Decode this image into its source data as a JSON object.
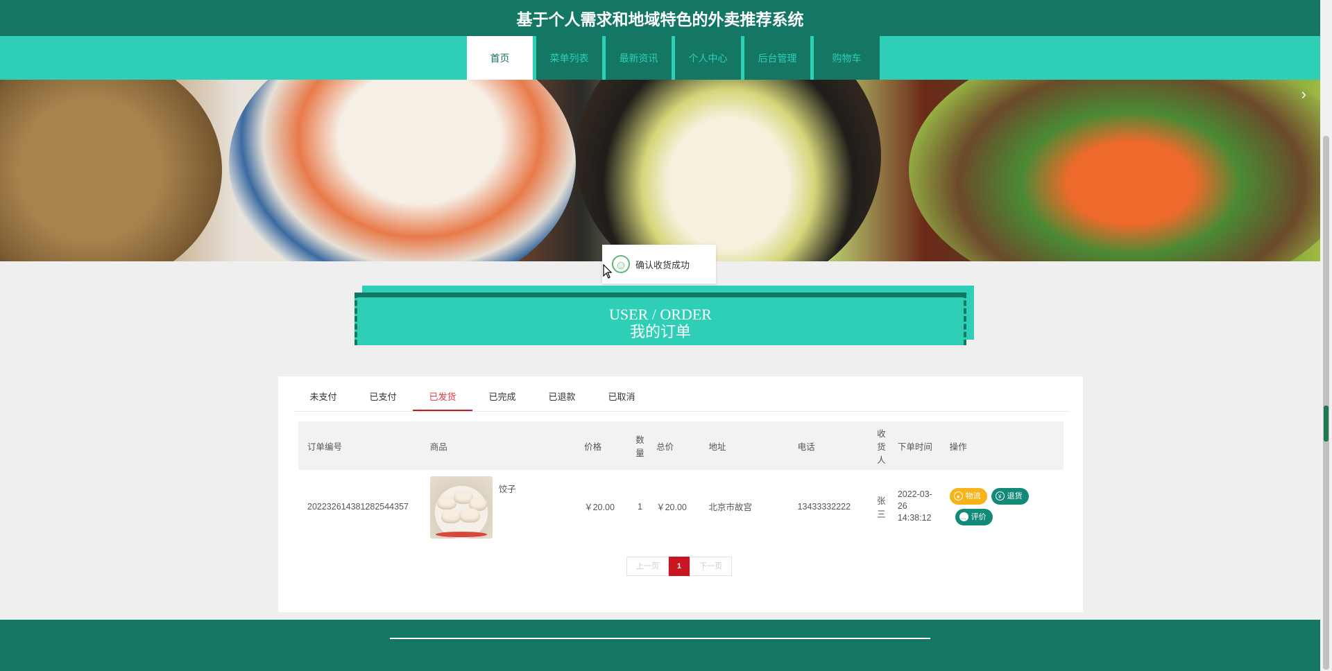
{
  "header": {
    "title": "基于个人需求和地域特色的外卖推荐系统"
  },
  "nav": {
    "items": [
      {
        "label": "首页",
        "active": true
      },
      {
        "label": "菜单列表",
        "active": false
      },
      {
        "label": "最新资讯",
        "active": false
      },
      {
        "label": "个人中心",
        "active": false
      },
      {
        "label": "后台管理",
        "active": false
      },
      {
        "label": "购物车",
        "active": false
      }
    ]
  },
  "banner": {
    "next_icon": "›"
  },
  "toast": {
    "icon": "smile-icon",
    "icon_glyph": "☺",
    "text": "确认收货成功"
  },
  "section": {
    "title_en": "USER / ORDER",
    "title_cn": "我的订单"
  },
  "tabs": {
    "items": [
      {
        "label": "未支付",
        "active": false
      },
      {
        "label": "已支付",
        "active": false
      },
      {
        "label": "已发货",
        "active": true
      },
      {
        "label": "已完成",
        "active": false
      },
      {
        "label": "已退款",
        "active": false
      },
      {
        "label": "已取消",
        "active": false
      }
    ]
  },
  "table": {
    "headers": [
      "订单编号",
      "商品",
      "价格",
      "数量",
      "总价",
      "地址",
      "电话",
      "收货人",
      "下单时间",
      "操作"
    ],
    "rows": [
      {
        "order_no": "20223261438128254435​7",
        "goods_name": "饺子",
        "price": "￥20.00",
        "quantity": "1",
        "total": "￥20.00",
        "address": "北京市故宫",
        "phone": "13433332222",
        "receiver": "张三",
        "order_time": "2022-03-26 14:38:12",
        "actions": {
          "logistics": "物流",
          "refund": "退货",
          "review": "评价"
        }
      }
    ]
  },
  "pagination": {
    "prev": "上一页",
    "current": "1",
    "next": "下一页"
  },
  "colors": {
    "dark_green": "#137764",
    "teal": "#2fcfb7",
    "red": "#c81623",
    "orange": "#f7b41a"
  }
}
